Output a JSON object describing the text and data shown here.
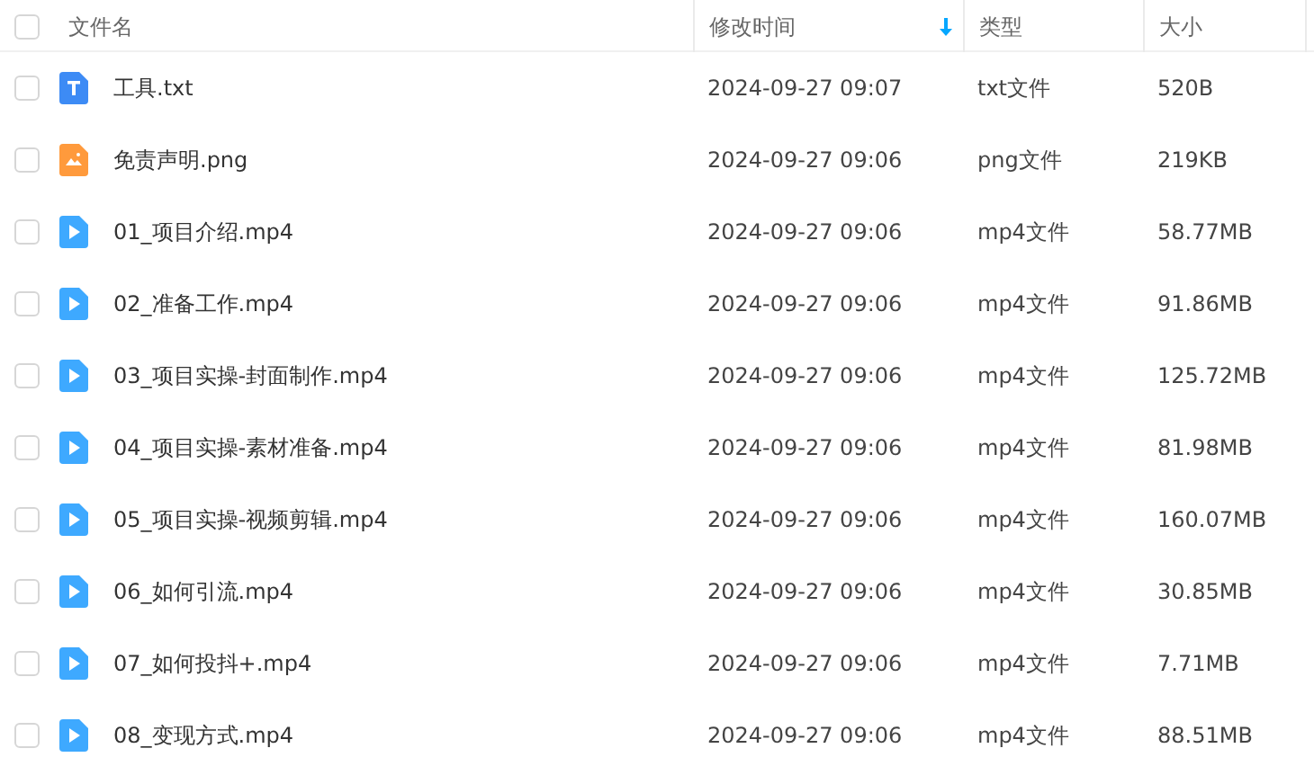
{
  "table": {
    "select_all": {
      "checked": false
    },
    "columns": [
      {
        "label": "文件名",
        "sorted": false
      },
      {
        "label": "修改时间",
        "sorted": true
      },
      {
        "label": "类型",
        "sorted": false
      },
      {
        "label": "大小",
        "sorted": false
      }
    ],
    "rows": [
      {
        "checked": false,
        "kind": "text",
        "name": "工具.txt",
        "modified": "2024-09-27 09:07",
        "type": "txt文件",
        "size": "520B"
      },
      {
        "checked": false,
        "kind": "image",
        "name": "免责声明.png",
        "modified": "2024-09-27 09:06",
        "type": "png文件",
        "size": "219KB"
      },
      {
        "checked": false,
        "kind": "video",
        "name": "01_项目介绍.mp4",
        "modified": "2024-09-27 09:06",
        "type": "mp4文件",
        "size": "58.77MB"
      },
      {
        "checked": false,
        "kind": "video",
        "name": "02_准备工作.mp4",
        "modified": "2024-09-27 09:06",
        "type": "mp4文件",
        "size": "91.86MB"
      },
      {
        "checked": false,
        "kind": "video",
        "name": "03_项目实操-封面制作.mp4",
        "modified": "2024-09-27 09:06",
        "type": "mp4文件",
        "size": "125.72MB"
      },
      {
        "checked": false,
        "kind": "video",
        "name": "04_项目实操-素材准备.mp4",
        "modified": "2024-09-27 09:06",
        "type": "mp4文件",
        "size": "81.98MB"
      },
      {
        "checked": false,
        "kind": "video",
        "name": "05_项目实操-视频剪辑.mp4",
        "modified": "2024-09-27 09:06",
        "type": "mp4文件",
        "size": "160.07MB"
      },
      {
        "checked": false,
        "kind": "video",
        "name": "06_如何引流.mp4",
        "modified": "2024-09-27 09:06",
        "type": "mp4文件",
        "size": "30.85MB"
      },
      {
        "checked": false,
        "kind": "video",
        "name": "07_如何投抖+.mp4",
        "modified": "2024-09-27 09:06",
        "type": "mp4文件",
        "size": "7.71MB"
      },
      {
        "checked": false,
        "kind": "video",
        "name": "08_变现方式.mp4",
        "modified": "2024-09-27 09:06",
        "type": "mp4文件",
        "size": "88.51MB"
      }
    ]
  }
}
